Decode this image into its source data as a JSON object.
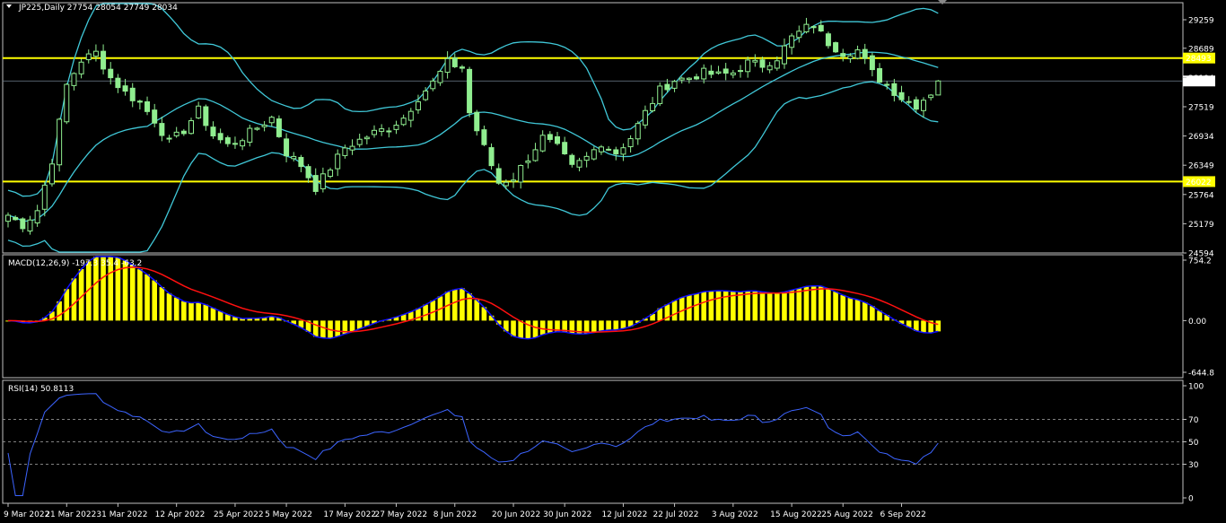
{
  "header": {
    "title": "JP225,Daily  27754 28054 27749 28034",
    "macd_label": "MACD(12,26,9) -197.3 35.4 -63.2",
    "rsi_label": "RSI(14) 50.8113"
  },
  "colors": {
    "background": "#000000",
    "frame": "#c0c0c0",
    "candle": "#90ee90",
    "bollinger": "#40c8d8",
    "support_resistance": "#ffff00",
    "histogram": "#ffff00",
    "macd_line": "#1010ff",
    "signal_line": "#ff1010",
    "rsi_line": "#3c64ff"
  },
  "chart_data": [
    {
      "type": "candlestick",
      "panel": "price",
      "ylim": [
        24594,
        29600
      ],
      "y_ticks": [
        "29259",
        "28689",
        "28104",
        "27519",
        "26934",
        "26349",
        "25764",
        "25179",
        "24594"
      ],
      "y_tick_values": [
        29259,
        28689,
        28104,
        27519,
        26934,
        26349,
        25764,
        25179,
        24594
      ],
      "x_ticks": [
        "9 Mar 2022",
        "21 Mar 2022",
        "31 Mar 2022",
        "12 Apr 2022",
        "25 Apr 2022",
        "5 May 2022",
        "17 May 2022",
        "27 May 2022",
        "8 Jun 2022",
        "20 Jun 2022",
        "30 Jun 2022",
        "12 Jul 2022",
        "22 Jul 2022",
        "3 Aug 2022",
        "15 Aug 2022",
        "25 Aug 2022",
        "6 Sep 2022"
      ],
      "x_tick_bars": [
        0,
        8,
        15,
        23,
        31,
        38,
        46,
        53,
        61,
        69,
        76,
        84,
        91,
        99,
        107,
        114,
        122
      ],
      "levels": [
        {
          "label": "28493",
          "value": 28493
        },
        {
          "label": "26022",
          "value": 26022
        }
      ],
      "current_price": {
        "label": "28034",
        "value": 28034
      },
      "close_anchors": [
        [
          0,
          25350
        ],
        [
          2,
          25150
        ],
        [
          4,
          25450
        ],
        [
          6,
          26450
        ],
        [
          8,
          27950
        ],
        [
          10,
          28450
        ],
        [
          12,
          28600
        ],
        [
          14,
          28100
        ],
        [
          16,
          27800
        ],
        [
          18,
          27600
        ],
        [
          20,
          27250
        ],
        [
          22,
          26800
        ],
        [
          24,
          27050
        ],
        [
          26,
          27450
        ],
        [
          28,
          26950
        ],
        [
          30,
          26750
        ],
        [
          32,
          26900
        ],
        [
          34,
          27100
        ],
        [
          36,
          27300
        ],
        [
          38,
          26600
        ],
        [
          40,
          26350
        ],
        [
          42,
          25900
        ],
        [
          44,
          26300
        ],
        [
          46,
          26700
        ],
        [
          48,
          26850
        ],
        [
          50,
          27000
        ],
        [
          52,
          27100
        ],
        [
          54,
          27300
        ],
        [
          56,
          27700
        ],
        [
          58,
          28000
        ],
        [
          60,
          28400
        ],
        [
          62,
          28300
        ],
        [
          63,
          27400
        ],
        [
          65,
          26700
        ],
        [
          67,
          26000
        ],
        [
          69,
          26100
        ],
        [
          71,
          26500
        ],
        [
          73,
          26900
        ],
        [
          75,
          26700
        ],
        [
          77,
          26300
        ],
        [
          79,
          26500
        ],
        [
          81,
          26800
        ],
        [
          83,
          26600
        ],
        [
          85,
          26900
        ],
        [
          87,
          27400
        ],
        [
          89,
          27850
        ],
        [
          91,
          28050
        ],
        [
          93,
          28100
        ],
        [
          95,
          28200
        ],
        [
          97,
          28150
        ],
        [
          99,
          28200
        ],
        [
          101,
          28400
        ],
        [
          103,
          28350
        ],
        [
          105,
          28500
        ],
        [
          107,
          28900
        ],
        [
          109,
          29100
        ],
        [
          110,
          29150
        ],
        [
          112,
          28800
        ],
        [
          114,
          28600
        ],
        [
          116,
          28650
        ],
        [
          118,
          28200
        ],
        [
          120,
          27950
        ],
        [
          122,
          27700
        ],
        [
          124,
          27550
        ],
        [
          126,
          27800
        ],
        [
          127,
          28034
        ]
      ],
      "bollinger_period": 20,
      "bollinger_deviation": 2
    },
    {
      "type": "bar",
      "panel": "macd",
      "ylim": [
        -644.8,
        754.2
      ],
      "y_ticks": [
        "754.2",
        "0.00",
        "-644.8"
      ],
      "y_tick_values": [
        754.2,
        0,
        -644.8
      ],
      "series": [
        {
          "name": "histogram",
          "values": "derived"
        },
        {
          "name": "macd",
          "values": "derived"
        },
        {
          "name": "signal",
          "values": "derived"
        }
      ],
      "fast": 12,
      "slow": 26,
      "signal": 9
    },
    {
      "type": "line",
      "panel": "rsi",
      "ylim": [
        0,
        100
      ],
      "y_ticks": [
        "100",
        "70",
        "50",
        "30",
        "0"
      ],
      "y_tick_values": [
        100,
        70,
        50,
        30,
        0
      ],
      "period": 14
    }
  ]
}
